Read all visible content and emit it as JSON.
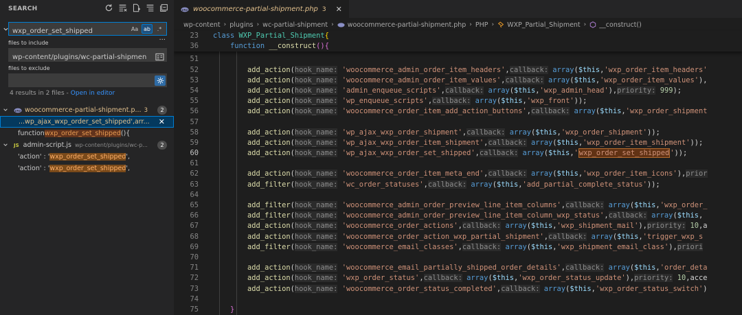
{
  "sidebar": {
    "title": "SEARCH",
    "header_icons": [
      "refresh-icon",
      "clear-results-icon",
      "new-search-editor-icon",
      "view-as-tree-icon",
      "collapse-all-icon"
    ],
    "search_value": "wxp_order_set_shipped",
    "options": {
      "match_case": "Aa",
      "whole_word": "ab",
      "regex": ".*"
    },
    "more": "···",
    "files_to_include_label": "files to include",
    "files_to_include_value": "wp-content/plugins/wc-partial-shipment",
    "files_to_exclude_label": "files to exclude",
    "files_to_exclude_value": "",
    "results_summary": "4 results in 2 files -",
    "open_in_editor": "Open in editor",
    "files": [
      {
        "name": "woocommerce-partial-shipment.p...",
        "mod_count": "3",
        "badge": "2",
        "matches": [
          {
            "pre": "...wp_ajax_",
            "hl": "wxp_order_set_shipped",
            "post": "',arr..."
          },
          {
            "pre": "function ",
            "hl": "wxp_order_set_shipped",
            "post": "(){"
          }
        ]
      },
      {
        "type": "JS",
        "name": "admin-script.js",
        "path": "wp-content/plugins/wc-p...",
        "badge": "2",
        "matches": [
          {
            "pre": "'action' : '",
            "hl": "wxp_order_set_shipped",
            "post": "',"
          },
          {
            "pre": "'action' : '",
            "hl": "wxp_order_set_shipped",
            "post": "',"
          }
        ]
      }
    ]
  },
  "editor": {
    "tab": {
      "name": "woocommerce-partial-shipment.php",
      "count": "3"
    },
    "breadcrumb": [
      "wp-content",
      "plugins",
      "wc-partial-shipment",
      "woocommerce-partial-shipment.php",
      "PHP",
      "WXP_Partial_Shipment",
      "__construct()"
    ],
    "current_line": "60"
  },
  "colors": {
    "accent": "#007fd4",
    "modified": "#e2c08d",
    "match_bg": "#613214"
  }
}
